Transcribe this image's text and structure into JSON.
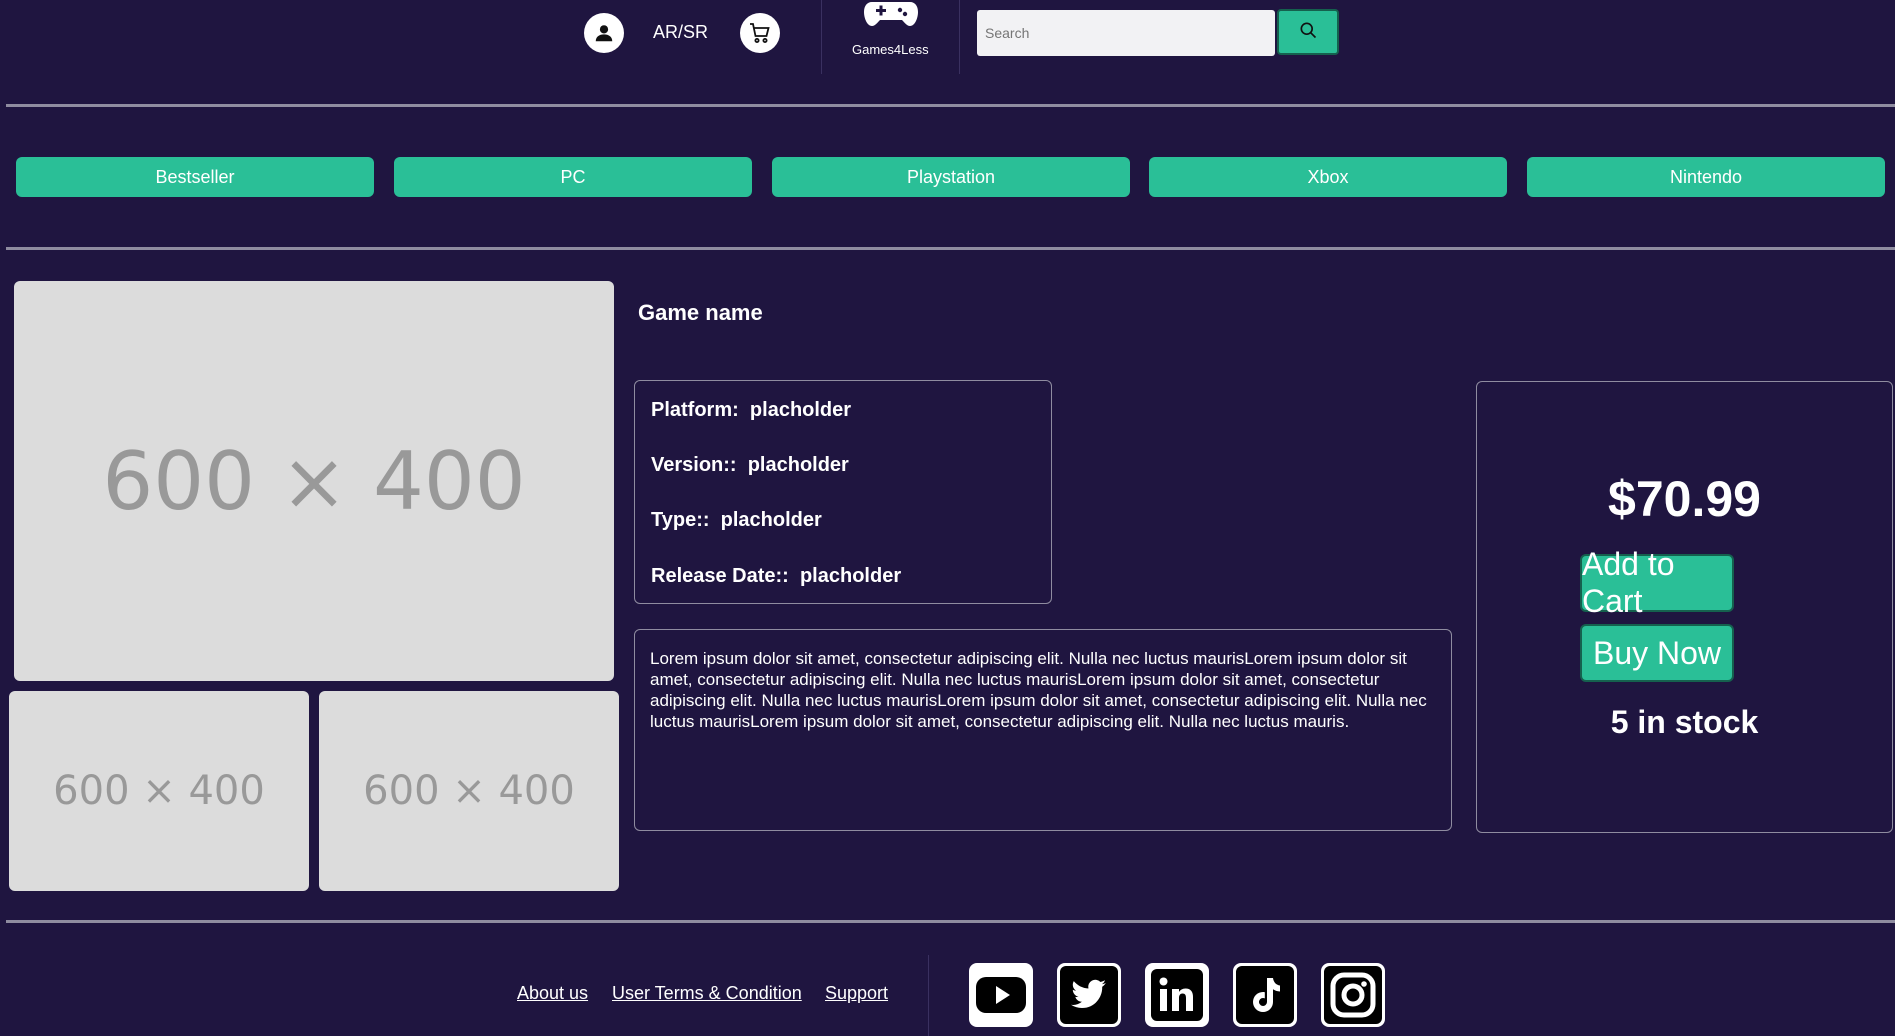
{
  "header": {
    "account_label": "AR/SR",
    "brand_name": "Games4Less",
    "search_placeholder": "Search"
  },
  "categories": [
    "Bestseller",
    "PC",
    "Playstation",
    "Xbox",
    "Nintendo"
  ],
  "product": {
    "name": "Game name",
    "main_image_label": "600 × 400",
    "thumb_1_label": "600 × 400",
    "thumb_2_label": "600 × 400",
    "specs": {
      "platform_label": "Platform:",
      "platform_value": "placholder",
      "version_label": "Version::",
      "version_value": "placholder",
      "type_label": "Type::",
      "type_value": "placholder",
      "release_label": "Release Date::",
      "release_value": "placholder"
    },
    "description": "Lorem ipsum dolor sit amet, consectetur adipiscing elit. Nulla nec luctus maurisLorem ipsum dolor sit amet, consectetur adipiscing elit. Nulla nec luctus maurisLorem ipsum dolor sit amet, consectetur adipiscing elit. Nulla nec luctus maurisLorem ipsum dolor sit amet, consectetur adipiscing elit. Nulla nec luctus maurisLorem ipsum dolor sit amet, consectetur adipiscing elit. Nulla nec luctus mauris.",
    "price": "$70.99",
    "add_to_cart_label": "Add to Cart",
    "buy_now_label": "Buy Now",
    "stock": "5 in stock"
  },
  "footer": {
    "links": [
      "About us",
      "User Terms & Condition",
      "Support"
    ],
    "social_icons": [
      "youtube-icon",
      "twitter-icon",
      "linkedin-icon",
      "tiktok-icon",
      "instagram-icon"
    ]
  },
  "colors": {
    "background": "#1f1540",
    "accent": "#2abf97",
    "divider": "#8f8ca0"
  }
}
